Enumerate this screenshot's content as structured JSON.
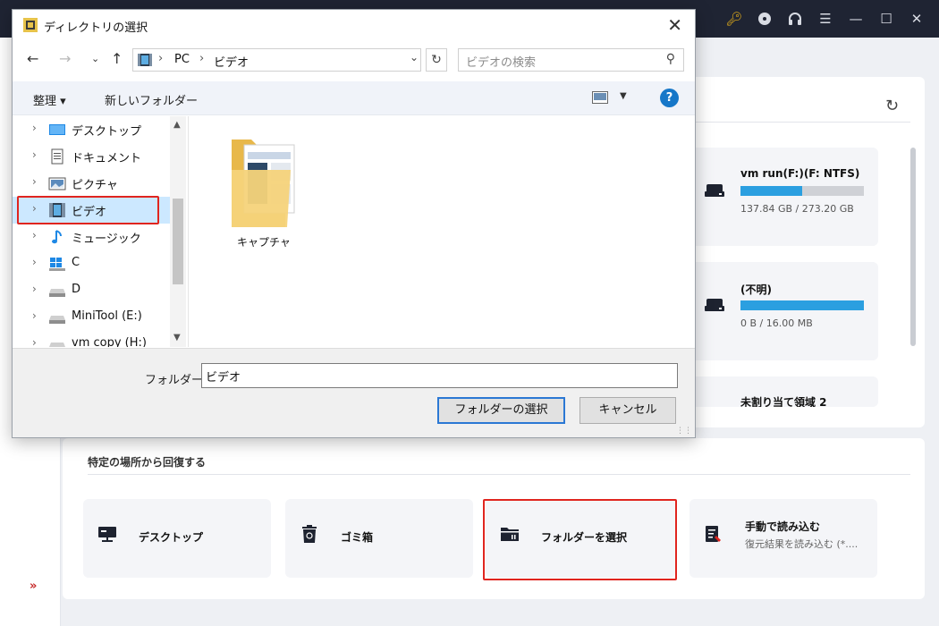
{
  "app": {
    "colors": {
      "accent": "#2b9fe0",
      "highlight": "#e0251f",
      "titlebar": "#1f2433"
    },
    "controls": [
      "key-icon",
      "disc-icon",
      "headset-icon",
      "menu-icon",
      "minimize-icon",
      "maximize-icon",
      "close-icon"
    ],
    "drives": [
      {
        "name": "vm run(F:)(F: NTFS)",
        "size": "137.84 GB / 273.20 GB",
        "used_fraction": 0.5
      },
      {
        "name": "(不明)",
        "size": "0 B / 16.00 MB",
        "used_fraction": 1.0
      },
      {
        "name": "未割り当て領域 2",
        "size": "",
        "used_fraction": 0
      }
    ],
    "section": {
      "title": "特定の場所から回復する",
      "locations": [
        {
          "label": "デスクトップ",
          "sub": ""
        },
        {
          "label": "ゴミ箱",
          "sub": ""
        },
        {
          "label": "フォルダーを選択",
          "sub": ""
        },
        {
          "label": "手動で読み込む",
          "sub": "復元結果を読み込む (*...."
        }
      ]
    }
  },
  "dialog": {
    "title": "ディレクトリの選択",
    "address": {
      "parts": [
        "PC",
        "ビデオ"
      ]
    },
    "search_placeholder": "ビデオの検索",
    "toolbar": {
      "organize": "整理 ▾",
      "new_folder": "新しいフォルダー"
    },
    "tree": [
      {
        "label": "デスクトップ",
        "icon": "desktop-icon"
      },
      {
        "label": "ドキュメント",
        "icon": "document-icon"
      },
      {
        "label": "ピクチャ",
        "icon": "picture-icon"
      },
      {
        "label": "ビデオ",
        "icon": "video-icon",
        "selected": true
      },
      {
        "label": "ミュージック",
        "icon": "music-icon"
      },
      {
        "label": "C",
        "icon": "windows-drive-icon"
      },
      {
        "label": "D",
        "icon": "drive-icon"
      },
      {
        "label": "MiniTool (E:)",
        "icon": "drive-icon"
      },
      {
        "label": "vm copy (H:)",
        "icon": "drive-icon"
      }
    ],
    "items": [
      {
        "label": "キャプチャ",
        "icon": "folder-icon"
      }
    ],
    "folder_label": "フォルダー:",
    "folder_value": "ビデオ",
    "buttons": {
      "select": "フォルダーの選択",
      "cancel": "キャンセル"
    }
  }
}
